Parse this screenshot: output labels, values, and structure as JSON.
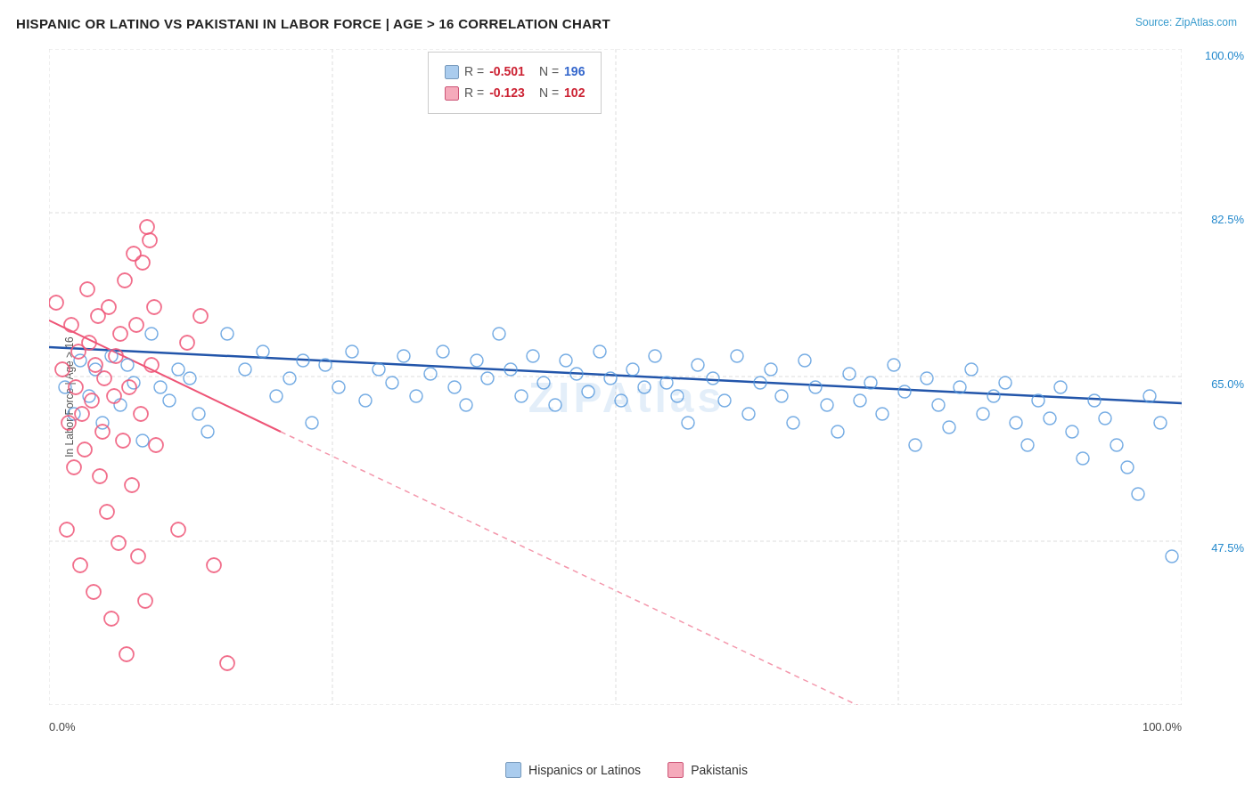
{
  "title": "HISPANIC OR LATINO VS PAKISTANI IN LABOR FORCE | AGE > 16 CORRELATION CHART",
  "source": "Source: ZipAtlas.com",
  "y_axis_label": "In Labor Force | Age > 16",
  "x_axis_labels": [
    "0.0%",
    "100.0%"
  ],
  "y_axis_values": [
    "100.0%",
    "82.5%",
    "65.0%",
    "47.5%"
  ],
  "legend": {
    "blue_r_label": "R = ",
    "blue_r_value": "-0.501",
    "blue_n_label": "N = ",
    "blue_n_value": "196",
    "pink_r_label": "R = ",
    "pink_r_value": "-0.123",
    "pink_n_label": "N = ",
    "pink_n_value": "102"
  },
  "bottom_legend": [
    {
      "label": "Hispanics or Latinos",
      "color": "#7ab3e0"
    },
    {
      "label": "Pakistanis",
      "color": "#f07090"
    }
  ],
  "watermark": "ZIPAtlas",
  "accent_color": "#2288cc",
  "blue_color": "#5599dd",
  "pink_color": "#ee6688"
}
